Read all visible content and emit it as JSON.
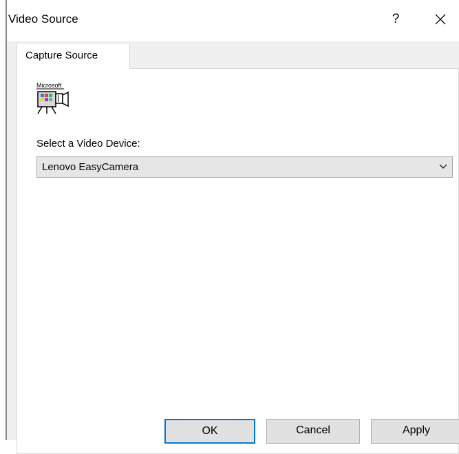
{
  "window": {
    "title": "Video Source",
    "help_label": "?"
  },
  "tabs": [
    {
      "label": "Capture Source"
    }
  ],
  "logo": {
    "text": "Microsoft",
    "icon": "video-camera-icon"
  },
  "device": {
    "label": "Select a Video Device:",
    "selected": "Lenovo EasyCamera"
  },
  "buttons": {
    "ok": "OK",
    "cancel": "Cancel",
    "apply": "Apply"
  },
  "colors": {
    "focus_border": "#0078d7",
    "dialog_bg": "#f0f0f0",
    "button_bg": "#e1e1e1"
  }
}
